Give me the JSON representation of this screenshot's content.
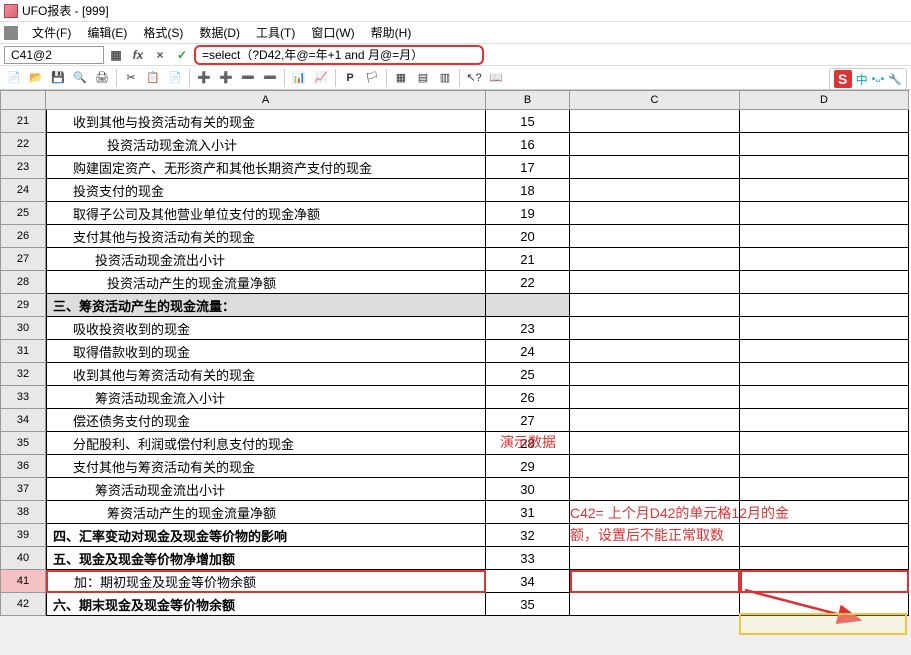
{
  "window": {
    "title": "UFO报表 - [999]"
  },
  "menu": {
    "file": "文件(F)",
    "edit": "编辑(E)",
    "format": "格式(S)",
    "data": "数据(D)",
    "tools": "工具(T)",
    "window": "窗口(W)",
    "help": "帮助(H)"
  },
  "cellref": "C41@2",
  "fx": {
    "label": "fx",
    "x": "×",
    "check": "✓"
  },
  "formula": "=select（?D42,年@=年+1 and 月@=月）",
  "ime": {
    "s": "S",
    "zh": "中",
    "emo": "•ᴗ•",
    "tool": "🔧"
  },
  "cols": {
    "a": "A",
    "b": "B",
    "c": "C",
    "d": "D"
  },
  "watermark": "演示数据",
  "annotation": {
    "line1": "C42= 上个月D42的单元格12月的金",
    "line2": "额，设置后不能正常取数"
  },
  "rows": [
    {
      "n": "21",
      "a": "收到其他与投资活动有关的现金",
      "b": "15",
      "cls": "indent1"
    },
    {
      "n": "22",
      "a": "投资活动现金流入小计",
      "b": "16",
      "cls": "indent3"
    },
    {
      "n": "23",
      "a": "购建固定资产、无形资产和其他长期资产支付的现金",
      "b": "17",
      "cls": "indent1"
    },
    {
      "n": "24",
      "a": "投资支付的现金",
      "b": "18",
      "cls": "indent1"
    },
    {
      "n": "25",
      "a": "取得子公司及其他营业单位支付的现金净额",
      "b": "19",
      "cls": "indent1"
    },
    {
      "n": "26",
      "a": "支付其他与投资活动有关的现金",
      "b": "20",
      "cls": "indent1"
    },
    {
      "n": "27",
      "a": "投资活动现金流出小计",
      "b": "21",
      "cls": "indent2"
    },
    {
      "n": "28",
      "a": "投资活动产生的现金流量净额",
      "b": "22",
      "cls": "indent3"
    },
    {
      "n": "29",
      "a": "三、筹资活动产生的现金流量：",
      "b": "",
      "cls": "section"
    },
    {
      "n": "30",
      "a": "吸收投资收到的现金",
      "b": "23",
      "cls": "indent1"
    },
    {
      "n": "31",
      "a": "取得借款收到的现金",
      "b": "24",
      "cls": "indent1"
    },
    {
      "n": "32",
      "a": "收到其他与筹资活动有关的现金",
      "b": "25",
      "cls": "indent1"
    },
    {
      "n": "33",
      "a": "筹资活动现金流入小计",
      "b": "26",
      "cls": "indent2"
    },
    {
      "n": "34",
      "a": "偿还债务支付的现金",
      "b": "27",
      "cls": "indent1"
    },
    {
      "n": "35",
      "a": "分配股利、利润或偿付利息支付的现金",
      "b": "28",
      "cls": "indent1"
    },
    {
      "n": "36",
      "a": "支付其他与筹资活动有关的现金",
      "b": "29",
      "cls": "indent1"
    },
    {
      "n": "37",
      "a": "筹资活动现金流出小计",
      "b": "30",
      "cls": "indent2"
    },
    {
      "n": "38",
      "a": "筹资活动产生的现金流量净额",
      "b": "31",
      "cls": "indent3"
    },
    {
      "n": "39",
      "a": "四、汇率变动对现金及现金等价物的影响",
      "b": "32",
      "cls": "bold"
    },
    {
      "n": "40",
      "a": "五、现金及现金等价物净增加额",
      "b": "33",
      "cls": "bold"
    },
    {
      "n": "41",
      "a": "加：期初现金及现金等价物余额",
      "b": "34",
      "cls": "indent1",
      "hl": true
    },
    {
      "n": "42",
      "a": "六、期末现金及现金等价物余额",
      "b": "35",
      "cls": "bold"
    }
  ]
}
